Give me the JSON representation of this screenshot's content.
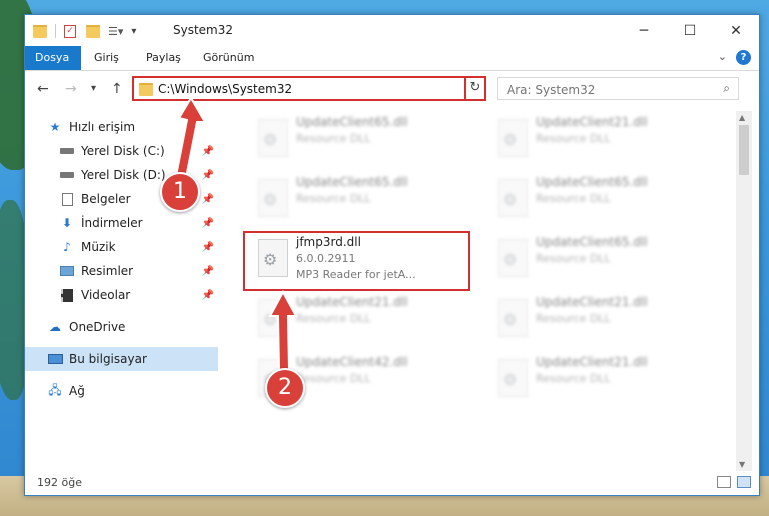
{
  "window": {
    "title": "System32"
  },
  "ribbon": {
    "tabs": [
      "Dosya",
      "Giriş",
      "Paylaş",
      "Görünüm"
    ],
    "help": "?"
  },
  "address": {
    "path": "C:\\Windows\\System32",
    "search_placeholder": "Ara: System32"
  },
  "sidebar": {
    "items": [
      {
        "label": "Hızlı erişim",
        "icon": "star-icon"
      },
      {
        "label": "Yerel Disk (C:)",
        "icon": "drive-icon",
        "pinned": true
      },
      {
        "label": "Yerel Disk (D:)",
        "icon": "drive-icon",
        "pinned": true
      },
      {
        "label": "Belgeler",
        "icon": "document-icon",
        "pinned": true
      },
      {
        "label": "İndirmeler",
        "icon": "download-icon",
        "pinned": true
      },
      {
        "label": "Müzik",
        "icon": "music-icon",
        "pinned": true
      },
      {
        "label": "Resimler",
        "icon": "pictures-icon",
        "pinned": true
      },
      {
        "label": "Videolar",
        "icon": "video-icon",
        "pinned": true
      },
      {
        "label": "OneDrive",
        "icon": "cloud-icon"
      },
      {
        "label": "Bu bilgisayar",
        "icon": "computer-icon",
        "selected": true
      },
      {
        "label": "Ağ",
        "icon": "network-icon"
      }
    ]
  },
  "files": [
    {
      "name": "UpdateClient65.dll",
      "line2": "Resource DLL",
      "line3": ""
    },
    {
      "name": "UpdateClient21.dll",
      "line2": "Resource DLL",
      "line3": ""
    },
    {
      "name": "UpdateClient65.dll",
      "line2": "Resource DLL",
      "line3": ""
    },
    {
      "name": "UpdateClient65.dll",
      "line2": "Resource DLL",
      "line3": ""
    },
    {
      "name": "jfmp3rd.dll",
      "line2": "6.0.0.2911",
      "line3": "MP3 Reader for jetA..."
    },
    {
      "name": "UpdateClient65.dll",
      "line2": "Resource DLL",
      "line3": ""
    },
    {
      "name": "UpdateClient21.dll",
      "line2": "Resource DLL",
      "line3": ""
    },
    {
      "name": "UpdateClient21.dll",
      "line2": "Resource DLL",
      "line3": ""
    },
    {
      "name": "UpdateClient42.dll",
      "line2": "Resource DLL",
      "line3": ""
    },
    {
      "name": "UpdateClient21.dll",
      "line2": "Resource DLL",
      "line3": ""
    }
  ],
  "status": {
    "count": "192 öğe"
  },
  "callouts": [
    "1",
    "2"
  ],
  "colors": {
    "accent": "#1979ca",
    "highlight": "#d32f2f",
    "callout": "#d9403a"
  }
}
